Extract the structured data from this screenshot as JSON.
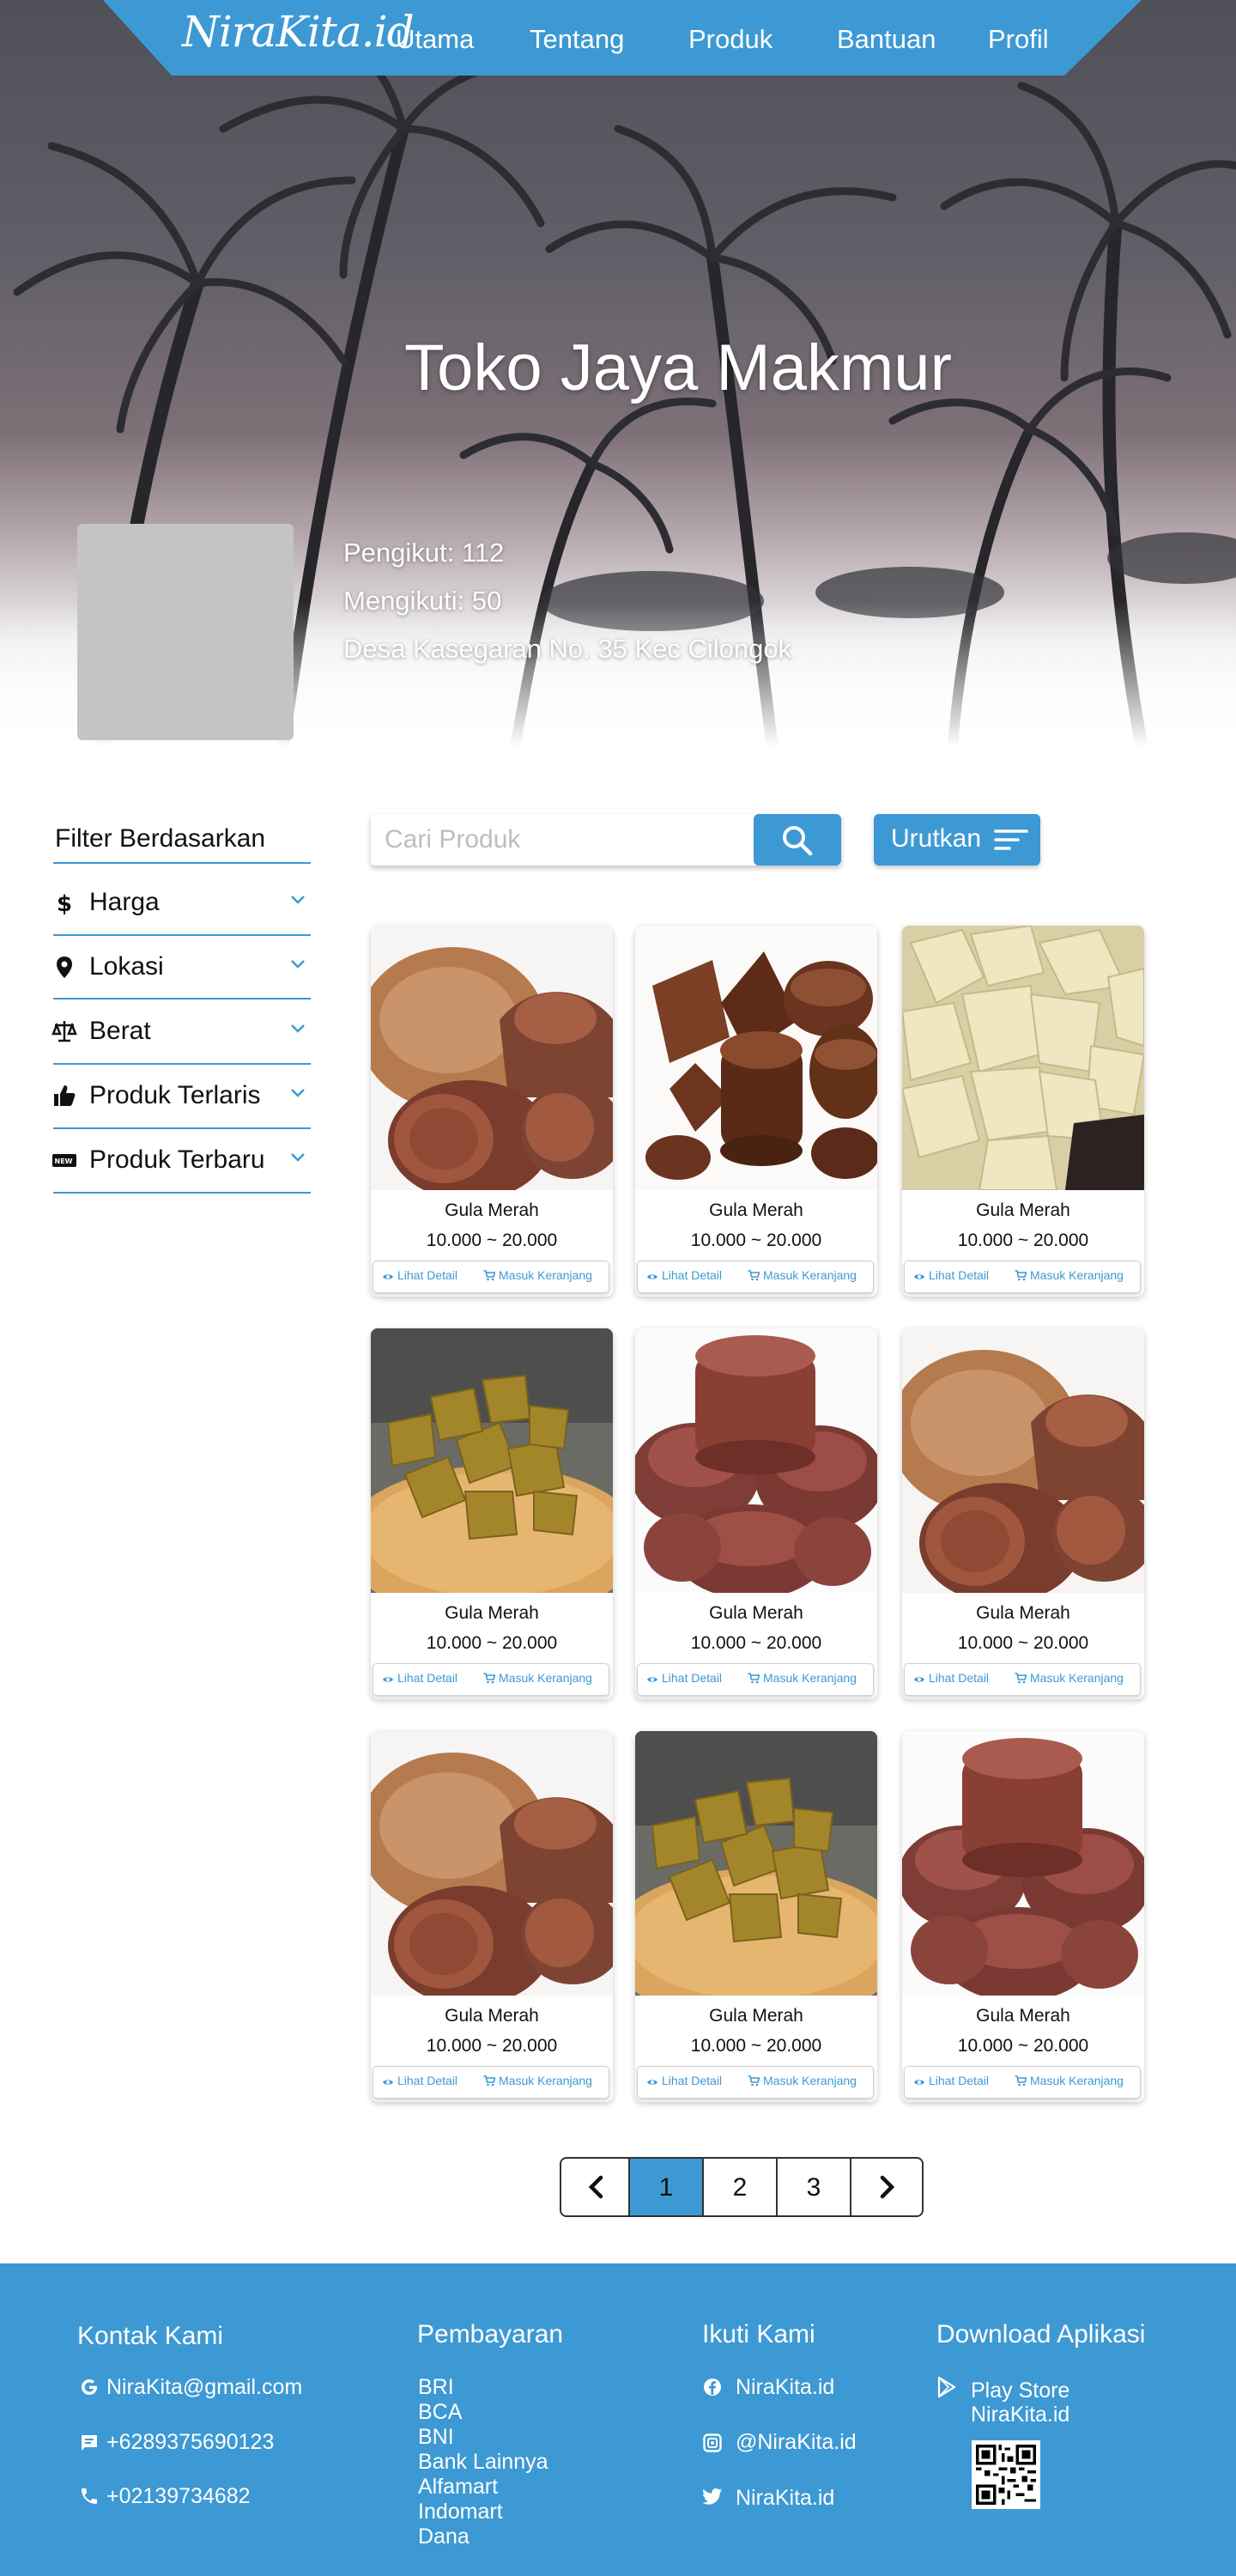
{
  "navbar": {
    "brand": "NiraKita.id",
    "items": [
      "Utama",
      "Tentang",
      "Produk",
      "Bantuan",
      "Profil"
    ]
  },
  "store": {
    "name": "Toko Jaya Makmur",
    "followers": "Pengikut: 112",
    "following": "Mengikuti: 50",
    "address": "Desa Kasegaran No. 35  Kec Cilongok"
  },
  "filter": {
    "title": "Filter Berdasarkan",
    "items": [
      {
        "label": "Harga",
        "icon": "dollar-icon"
      },
      {
        "label": "Lokasi",
        "icon": "location-pin-icon"
      },
      {
        "label": "Berat",
        "icon": "scale-icon"
      },
      {
        "label": "Produk Terlaris",
        "icon": "thumbs-up-icon"
      },
      {
        "label": "Produk Terbaru",
        "icon": "new-badge-icon"
      }
    ]
  },
  "search": {
    "placeholder": "Cari Produk",
    "button_icon": "search-icon"
  },
  "sort": {
    "label": "Urutkan",
    "icon": "sort-icon"
  },
  "products": [
    {
      "name": "Gula Merah",
      "price": "10.000 ~ 20.000",
      "image": "brown-sugar-blocks"
    },
    {
      "name": "Gula Merah",
      "price": "10.000 ~ 20.000",
      "image": "dark-palm-sugar"
    },
    {
      "name": "Gula Merah",
      "price": "10.000 ~ 20.000",
      "image": "rock-sugar-crystals"
    },
    {
      "name": "Gula Merah",
      "price": "10.000 ~ 20.000",
      "image": "sugar-pieces-on-plate"
    },
    {
      "name": "Gula Merah",
      "price": "10.000 ~ 20.000",
      "image": "red-sugar-discs"
    },
    {
      "name": "Gula Merah",
      "price": "10.000 ~ 20.000",
      "image": "brown-sugar-blocks"
    },
    {
      "name": "Gula Merah",
      "price": "10.000 ~ 20.000",
      "image": "brown-sugar-blocks"
    },
    {
      "name": "Gula Merah",
      "price": "10.000 ~ 20.000",
      "image": "sugar-pieces-on-plate"
    },
    {
      "name": "Gula Merah",
      "price": "10.000 ~ 20.000",
      "image": "red-sugar-discs"
    }
  ],
  "product_actions": {
    "detail_label": "Lihat Detail",
    "detail_icon": "eye-icon",
    "cart_label": "Masuk Keranjang",
    "cart_icon": "cart-icon"
  },
  "pagination": {
    "pages": [
      "1",
      "2",
      "3"
    ],
    "active": "1",
    "prev_icon": "chevron-left-icon",
    "next_icon": "chevron-right-icon"
  },
  "footer": {
    "contact": {
      "title": "Kontak Kami",
      "email": "NiraKita@gmail.com",
      "whatsapp": "+6289375690123",
      "phone": "+02139734682"
    },
    "payment": {
      "title": "Pembayaran",
      "methods": [
        "BRI",
        "BCA",
        "BNI",
        "Bank Lainnya",
        "Alfamart",
        "Indomart",
        "Dana"
      ]
    },
    "social": {
      "title": "Ikuti Kami",
      "facebook": "NiraKita.id",
      "instagram": "@NiraKita.id",
      "twitter": "NiraKita.id"
    },
    "app": {
      "title": "Download Aplikasi",
      "store": "Play Store",
      "name": "NiraKita.id"
    }
  },
  "colors": {
    "accent": "#3d99d3",
    "hero_dark": "#4f5058",
    "placeholder_gray": "#c4c4c4"
  }
}
